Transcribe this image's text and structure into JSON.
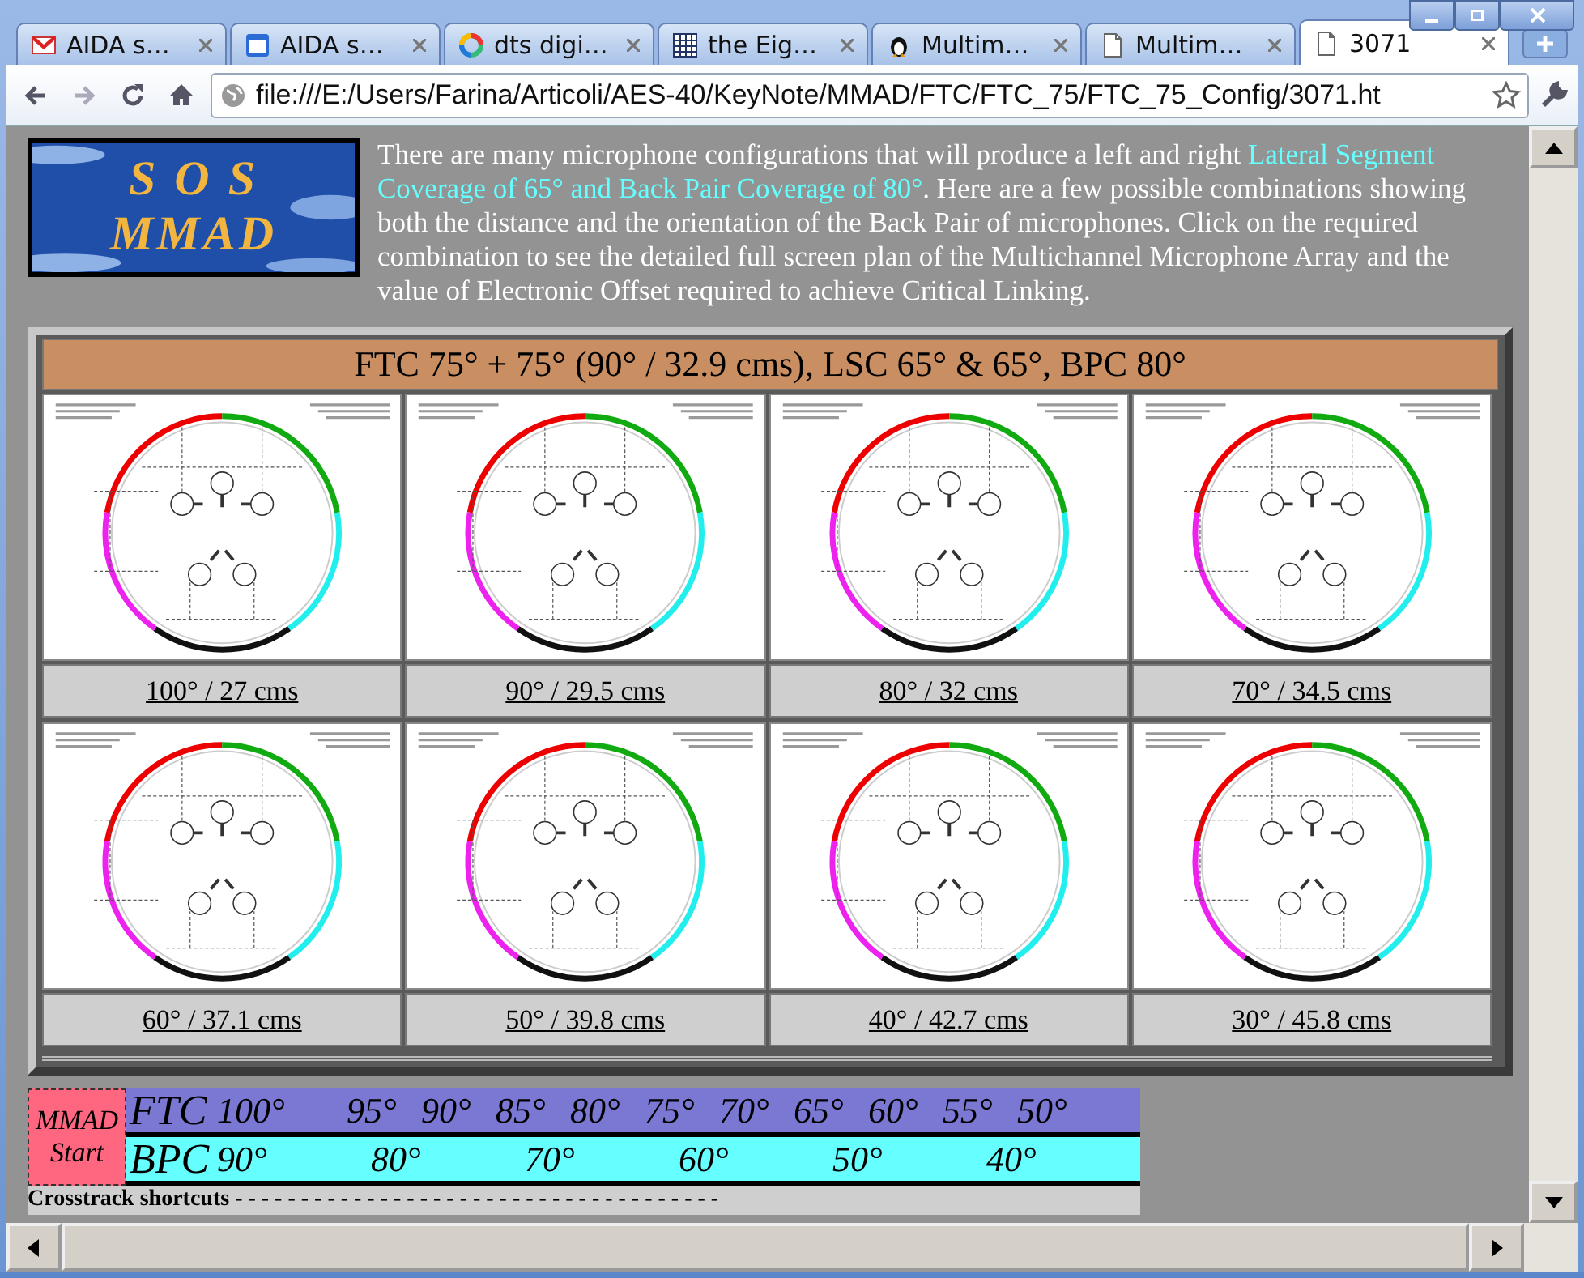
{
  "browser": {
    "tabs": [
      {
        "title": "AIDA s…",
        "kind": "mail",
        "selected": false
      },
      {
        "title": "AIDA s…",
        "kind": "calendar",
        "selected": false
      },
      {
        "title": "dts digi…",
        "kind": "search",
        "selected": false
      },
      {
        "title": "the Eig…",
        "kind": "grid",
        "selected": false
      },
      {
        "title": "Multim…",
        "kind": "penguin",
        "selected": false
      },
      {
        "title": "Multim…",
        "kind": "page",
        "selected": false
      },
      {
        "title": "3071",
        "kind": "page",
        "selected": true
      }
    ],
    "address": "file:///E:/Users/Farina/Articoli/AES-40/KeyNote/MMAD/FTC/FTC_75/FTC_75_Config/3071.ht"
  },
  "page": {
    "logo": {
      "line_1": "S O S",
      "line_2": "MMAD"
    },
    "intro": [
      {
        "text": "There are many microphone configurations that will produce a left and right ",
        "highlighted": false
      },
      {
        "text": "Lateral Segment Coverage of 65° and Back Pair Coverage of 80°",
        "highlighted": true
      },
      {
        "text": ". Here are a few possible combinations showing both the distance and the orientation of the Back Pair of microphones. Click on the required combination to see the detailed full screen plan of the Multichannel Microphone Array and the value of Electronic Offset required to achieve Critical Linking.",
        "highlighted": false
      }
    ],
    "table_title": "FTC 75° + 75° (90° / 32.9 cms), LSC 65° & 65°, BPC 80°",
    "configurations": [
      {
        "caption": "100° / 27 cms"
      },
      {
        "caption": "90° / 29.5 cms"
      },
      {
        "caption": "80° / 32 cms"
      },
      {
        "caption": "70° / 34.5 cms"
      },
      {
        "caption": "60° / 37.1 cms"
      },
      {
        "caption": "50° / 39.8 cms"
      },
      {
        "caption": "40° / 42.7 cms"
      },
      {
        "caption": "30° / 45.8 cms"
      }
    ],
    "navigator": {
      "start": "MMAD Start",
      "ftc_label": "FTC",
      "ftc_ticks": [
        "100°",
        "95°",
        "90°",
        "85°",
        "80°",
        "75°",
        "70°",
        "65°",
        "60°",
        "55°",
        "50°"
      ],
      "bpc_label": "BPC",
      "bpc_ticks": [
        "90°",
        "80°",
        "70°",
        "60°",
        "50°",
        "40°"
      ],
      "shortcuts": "Crosstrack shortcuts - - - - - - - - - - - - - - - - - - - - - - - - - - - - - - - - - - - - -"
    }
  }
}
